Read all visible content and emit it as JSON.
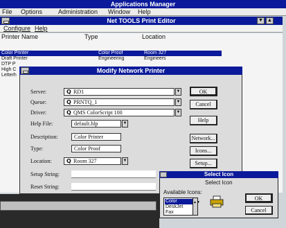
{
  "app": {
    "title": "Applications Manager",
    "menu": [
      "File",
      "Options",
      "Administration",
      "Window",
      "Help"
    ]
  },
  "print_editor": {
    "title": "Net TOOLS Print Editor",
    "menu": [
      "Configure",
      "Help"
    ],
    "columns": [
      "Printer Name",
      "Type",
      "Location"
    ],
    "rows": [
      {
        "name": "Color Printer",
        "type": "Color Proof",
        "location": "Room 327",
        "selected": true
      },
      {
        "name": "Draft Printer",
        "type": "Engineering",
        "location": "Engineers",
        "selected": false
      },
      {
        "name": "DTP P",
        "type": "",
        "location": "",
        "selected": false
      },
      {
        "name": "High C",
        "type": "",
        "location": "",
        "selected": false
      },
      {
        "name": "Letterh",
        "type": "",
        "location": "",
        "selected": false
      }
    ]
  },
  "modify_dialog": {
    "title": "Modify Network Printer",
    "labels": {
      "server": "Server:",
      "queue": "Queue:",
      "driver": "Driver:",
      "help_file": "Help File:",
      "description": "Description:",
      "type": "Type:",
      "location": "Location:",
      "setup_string": "Setup String:",
      "reset_string": "Reset String:"
    },
    "values": {
      "server": "RD1",
      "queue": "PRNTQ_1",
      "driver": "QMS ColorScript 100",
      "help_file": "default.hlp",
      "description": "Color Printer",
      "type": "Color Proof",
      "location": "Room 327",
      "setup_string": "",
      "reset_string": ""
    },
    "buttons": {
      "ok": "OK",
      "cancel": "Cancel",
      "help": "Help",
      "network": "Network...",
      "icons": "Icons...",
      "setup": "Setup..."
    }
  },
  "select_icon": {
    "title": "Select Icon",
    "heading": "Select Icon",
    "available_label": "Available Icons:",
    "icons": [
      "Color",
      "DeskJet",
      "Fax"
    ],
    "selected": "Color",
    "buttons": {
      "ok": "OK",
      "cancel": "Cancel"
    }
  },
  "colors": {
    "titlebar": "#0a1a9a",
    "face": "#dcdcdc",
    "selection": "#0a1a9a"
  }
}
